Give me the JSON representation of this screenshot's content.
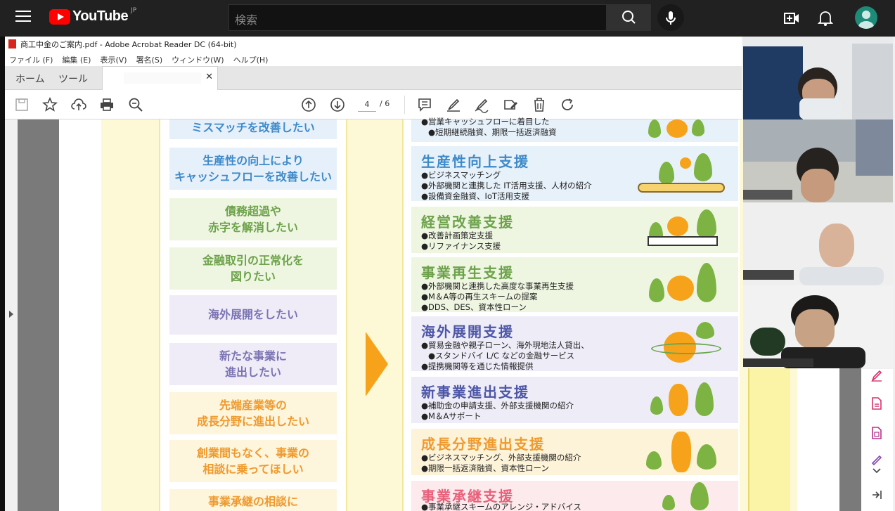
{
  "youtube": {
    "logo_text": "YouTube",
    "country_code": "JP",
    "search_placeholder": "検索",
    "icons": [
      "menu-icon",
      "search-icon",
      "mic-icon",
      "create-icon",
      "bell-icon",
      "avatar"
    ]
  },
  "acrobat": {
    "window_title": "商工中金のご案内.pdf - Adobe Acrobat Reader DC (64-bit)",
    "menu": [
      "ファイル (F)",
      "編集 (E)",
      "表示(V)",
      "署名(S)",
      "ウィンドウ(W)",
      "ヘルプ(H)"
    ],
    "tabs": {
      "home": "ホーム",
      "tools": "ツール"
    },
    "page_current": "4",
    "page_total": "/ 6"
  },
  "left_items": [
    {
      "text": "ミスマッチを改善したい",
      "color": "blue"
    },
    {
      "line1": "生産性の向上により",
      "line2": "キャッシュフローを改善したい",
      "color": "blue"
    },
    {
      "line1": "債務超過や",
      "line2": "赤字を解消したい",
      "color": "green"
    },
    {
      "line1": "金融取引の正常化を",
      "line2": "図りたい",
      "color": "green"
    },
    {
      "text": "海外展開をしたい",
      "color": "purple"
    },
    {
      "line1": "新たな事業に",
      "line2": "進出したい",
      "color": "purple"
    },
    {
      "line1": "先端産業等の",
      "line2": "成長分野に進出したい",
      "color": "orange"
    },
    {
      "line1": "創業間もなく、事業の",
      "line2": "相談に乗ってほしい",
      "color": "orange"
    },
    {
      "text": "事業承継の相談に",
      "color": "orange"
    }
  ],
  "right_items": [
    {
      "bullets": [
        "営業キャッシュフローに着目した",
        "短期継続融資、期限一括返済融資"
      ]
    },
    {
      "title": "生産性向上支援",
      "bullets": [
        "ビジネスマッチング",
        "外部機関と連携した IT活用支援、人材の紹介",
        "設備資金融資、IoT活用支援"
      ]
    },
    {
      "title": "経営改善支援",
      "bullets": [
        "改善計画策定支援",
        "リファイナンス支援"
      ]
    },
    {
      "title": "事業再生支援",
      "bullets": [
        "外部機関と連携した高度な事業再生支援",
        "M＆A等の再生スキームの提案",
        "DDS、DES、資本性ローン"
      ]
    },
    {
      "title": "海外展開支援",
      "bullets": [
        "貿易金融や親子ローン、海外現地法人貸出、",
        "スタンドバイ L/C などの金融サービス",
        "提携機関等を通じた情報提供"
      ]
    },
    {
      "title": "新事業進出支援",
      "bullets": [
        "補助金の申請支援、外部支援機関の紹介",
        "M＆Aサポート"
      ]
    },
    {
      "title": "成長分野進出支援",
      "bullets": [
        "ビジネスマッチング、外部支援機関の紹介",
        "期限一括返済融資、資本性ローン"
      ]
    },
    {
      "title": "事業承継支援",
      "bullets": [
        "事業承継スキームのアレンジ・アドバイス"
      ]
    }
  ],
  "colors": {
    "blue_title": "#3f8ac9",
    "green_title": "#6da24b",
    "purple_title": "#4d56a7",
    "orange_title": "#ef9a2e",
    "pink_title": "#e8617b",
    "arrow": "#f7a21b"
  }
}
